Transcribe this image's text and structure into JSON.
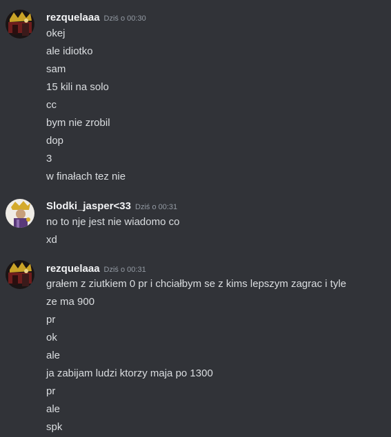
{
  "messages": [
    {
      "author": "rezquelaaa",
      "timestamp": "Dziś o 00:30",
      "avatar_icon": "user-avatar-icon",
      "lines": [
        "okej",
        "ale idiotko",
        "sam",
        "15 kili na solo",
        "cc",
        "bym nie zrobil",
        "dop",
        "3",
        "w finałach tez nie"
      ]
    },
    {
      "author": "Slodki_jasper<33",
      "timestamp": "Dziś o 00:31",
      "avatar_icon": "user-avatar-icon",
      "lines": [
        "no to nje jest nie wiadomo co",
        "xd"
      ]
    },
    {
      "author": "rezquelaaa",
      "timestamp": "Dziś o 00:31",
      "avatar_icon": "user-avatar-icon",
      "lines": [
        "grałem z ziutkiem 0 pr i chciałbym se z kims lepszym zagrac i tyle",
        "ze ma 900",
        "pr",
        "ok",
        "ale",
        "ja zabijam ludzi ktorzy maja po 1300",
        "pr",
        "ale",
        "spk"
      ]
    }
  ],
  "colors": {
    "background": "#313338",
    "username": "#f2f3f5",
    "message_text": "#dbdee1",
    "timestamp": "#949ba4"
  }
}
